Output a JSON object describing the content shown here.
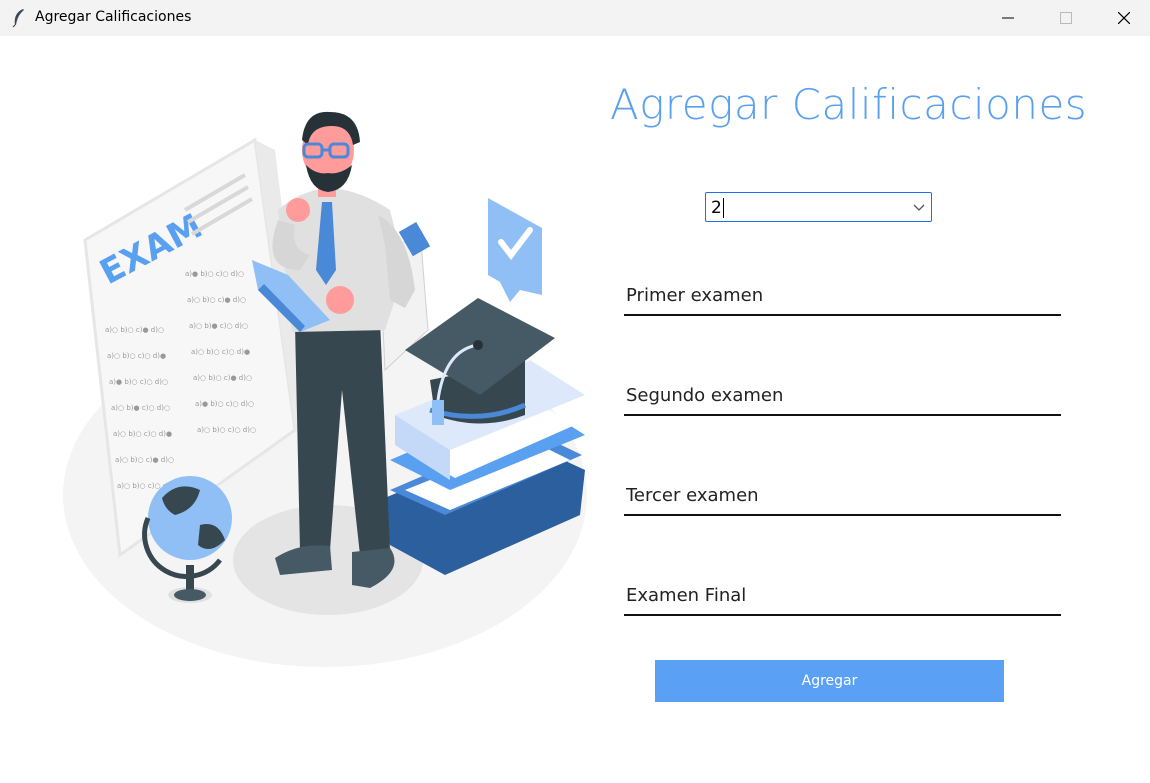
{
  "window": {
    "title": "Agregar Calificaciones",
    "icon": "feather-icon",
    "controls": [
      "minimize-icon",
      "maximize-icon",
      "close-icon"
    ]
  },
  "illustration": {
    "sheet_title": "EXAM"
  },
  "form": {
    "heading": "Agregar Calificaciones",
    "selector_value": "2",
    "fields": [
      {
        "label": "Primer examen"
      },
      {
        "label": "Segundo examen"
      },
      {
        "label": "Tercer examen"
      },
      {
        "label": "Examen Final"
      }
    ],
    "submit_label": "Agregar"
  },
  "colors": {
    "accent": "#5aa0f5",
    "heading": "#5aa0f0",
    "combo_border": "#1a73e8",
    "underline": "#111111"
  }
}
